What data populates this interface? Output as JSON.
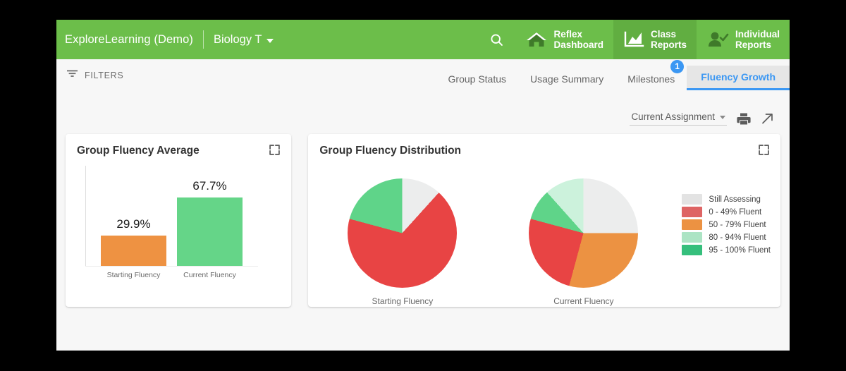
{
  "header": {
    "brand": "ExploreLearning (Demo)",
    "class_name": "Biology T",
    "search_icon": "search-icon",
    "nav": [
      {
        "label": "Reflex\nDashboard",
        "icon": "home-icon",
        "active": false
      },
      {
        "label": "Class\nReports",
        "icon": "chart-icon",
        "active": true
      },
      {
        "label": "Individual\nReports",
        "icon": "person-check-icon",
        "active": false
      }
    ],
    "colors": {
      "bar": "#6cbe4a",
      "active_tab": "#61ae41"
    }
  },
  "subbar": {
    "filters_label": "FILTERS",
    "filters_icon": "filter-icon",
    "tabs": [
      {
        "label": "Group Status",
        "active": false,
        "badge": null
      },
      {
        "label": "Usage Summary",
        "active": false,
        "badge": null
      },
      {
        "label": "Milestones",
        "active": false,
        "badge": "1"
      },
      {
        "label": "Fluency Growth",
        "active": true,
        "badge": null
      }
    ],
    "accent": "#3b97f3"
  },
  "toolbar": {
    "assignment_label": "Current Assignment",
    "print_icon": "printer-icon",
    "expand_icon": "external-link-icon"
  },
  "cards": {
    "left": {
      "title": "Group Fluency Average",
      "expand_icon": "fullscreen-icon"
    },
    "right": {
      "title": "Group Fluency Distribution",
      "expand_icon": "fullscreen-icon"
    }
  },
  "chart_data": [
    {
      "type": "bar",
      "title": "Group Fluency Average",
      "categories": [
        "Starting Fluency",
        "Current Fluency"
      ],
      "values": [
        29.9,
        67.7
      ],
      "value_labels": [
        "29.9%",
        "67.7%"
      ],
      "colors": [
        "#ee9242",
        "#65d588"
      ],
      "ylabel": "",
      "xlabel": "",
      "ylim": [
        0,
        100
      ],
      "grid": false
    },
    {
      "type": "pie",
      "title": "Group Fluency Distribution",
      "legend_position": "right",
      "legend": [
        {
          "label": "Still Assessing",
          "color": "#e3e3e3"
        },
        {
          "label": "0 - 49% Fluent",
          "color": "#de6464"
        },
        {
          "label": "50 - 79% Fluent",
          "color": "#ec9242"
        },
        {
          "label": "80 - 94% Fluent",
          "color": "#ace4c4"
        },
        {
          "label": "95 - 100% Fluent",
          "color": "#35bf7c"
        }
      ],
      "pies": [
        {
          "label": "Starting Fluency",
          "slices": [
            {
              "name": "Still Assessing",
              "percent": 11.7,
              "color": "#eceded"
            },
            {
              "name": "0 - 49% Fluent",
              "percent": 67.5,
              "color": "#e84444"
            },
            {
              "name": "50 - 79% Fluent",
              "percent": 0,
              "color": "#ec9242"
            },
            {
              "name": "80 - 94% Fluent",
              "percent": 0,
              "color": "#ccf2dc"
            },
            {
              "name": "95 - 100% Fluent",
              "percent": 20.8,
              "color": "#5fd489"
            }
          ]
        },
        {
          "label": "Current Fluency",
          "slices": [
            {
              "name": "Still Assessing",
              "percent": 25.0,
              "color": "#eceded"
            },
            {
              "name": "50 - 79% Fluent",
              "percent": 29.2,
              "color": "#ec9242"
            },
            {
              "name": "0 - 49% Fluent",
              "percent": 25.0,
              "color": "#e84444"
            },
            {
              "name": "95 - 100% Fluent",
              "percent": 9.2,
              "color": "#5fd489"
            },
            {
              "name": "80 - 94% Fluent",
              "percent": 11.6,
              "color": "#ccf2dc"
            }
          ]
        }
      ]
    }
  ]
}
